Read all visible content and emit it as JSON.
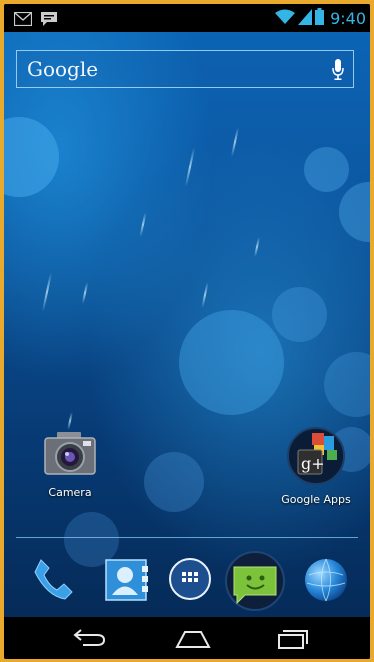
{
  "status_bar": {
    "time": "9:40",
    "left_icons": [
      "gmail-icon",
      "messaging-icon"
    ],
    "right_icons": [
      "wifi-icon",
      "signal-icon",
      "battery-icon"
    ],
    "accent_color": "#35b5e5"
  },
  "search": {
    "label": "Google",
    "mic_icon": "microphone-icon"
  },
  "apps": [
    {
      "label": "Camera",
      "icon": "camera-icon"
    },
    {
      "label": "Google Apps",
      "icon": "google-apps-folder-icon"
    }
  ],
  "dock": [
    "phone-icon",
    "people-icon",
    "app-drawer-icon",
    "messaging-icon",
    "browser-icon"
  ],
  "nav": [
    "back-icon",
    "home-icon",
    "recent-apps-icon"
  ]
}
